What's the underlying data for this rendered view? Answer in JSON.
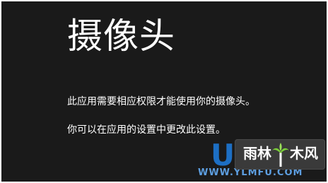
{
  "dialog": {
    "title": "摄像头",
    "message_line1": "此应用需要相应权限才能使用你的摄像头。",
    "message_line2": "你可以在应用的设置中更改此设置。"
  },
  "watermark": {
    "letter": "U",
    "text_left": "雨林",
    "text_right": "木风",
    "url": "WWW.YLMFU.COM",
    "icon": "tree-icon"
  },
  "colors": {
    "background": "#1a1a1a",
    "text": "#ffffff",
    "watermark_blue": "#1d6fc4"
  }
}
